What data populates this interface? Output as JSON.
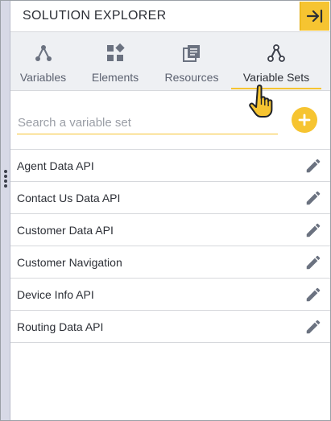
{
  "header": {
    "title": "SOLUTION EXPLORER",
    "collapse_icon": "arrow-right-to-bar-icon",
    "accent": "#f6c431"
  },
  "tabs": [
    {
      "label": "Variables",
      "icon": "variables-icon"
    },
    {
      "label": "Elements",
      "icon": "elements-icon"
    },
    {
      "label": "Resources",
      "icon": "resources-icon"
    },
    {
      "label": "Variable Sets",
      "icon": "variable-sets-icon",
      "active": true
    }
  ],
  "search": {
    "placeholder": "Search a variable set",
    "value": ""
  },
  "add_button_icon": "plus-icon",
  "variable_sets": [
    {
      "label": "Agent Data API"
    },
    {
      "label": "Contact Us Data API"
    },
    {
      "label": "Customer Data API"
    },
    {
      "label": "Customer Navigation"
    },
    {
      "label": "Device Info API"
    },
    {
      "label": "Routing Data API"
    }
  ],
  "row_action_icon": "pencil-icon",
  "colors": {
    "accent": "#f6c431",
    "tab_bar": "#eef0f3",
    "icon": "#6b7280"
  }
}
